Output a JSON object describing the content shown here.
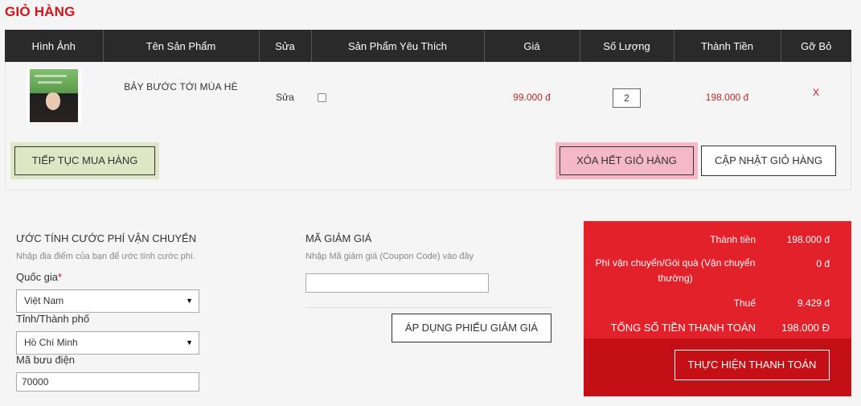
{
  "page": {
    "title": "GIỎ HÀNG"
  },
  "cart_table": {
    "headers": [
      "Hình Ảnh",
      "Tên Sản Phẩm",
      "Sửa",
      "Sản Phẩm Yêu Thích",
      "Giá",
      "Số Lượng",
      "Thành Tiền",
      "Gỡ Bỏ"
    ],
    "rows": [
      {
        "name": "BẢY BƯỚC TỚI MÙA HÈ",
        "edit": "Sửa",
        "favorite_checked": false,
        "price": "99.000 đ",
        "quantity": "2",
        "total": "198.000 đ",
        "remove": "X"
      }
    ]
  },
  "actions": {
    "continue": "TIẾP TỤC MUA HÀNG",
    "clear": "XÓA HẾT GIỎ HÀNG",
    "update": "CẬP NHẬT GIỎ HÀNG"
  },
  "shipping": {
    "title": "ƯỚC TÍNH CƯỚC PHÍ VẬN CHUYỂN",
    "description": "Nhập địa điểm của bạn để ước tính cước phí.",
    "country_label": "Quốc gia",
    "required_mark": "*",
    "country_value": "Việt Nam",
    "city_label": "Tỉnh/Thành phố",
    "city_value": "Hồ Chí Minh",
    "zip_label": "Mã bưu điện",
    "zip_value": "70000",
    "caret": "▼"
  },
  "coupon": {
    "title": "MÃ GIẢM GIÁ",
    "description": "Nhập Mã giảm giá (Coupon Code) vào đây",
    "input_value": "",
    "apply": "ÁP DỤNG PHIẾU GIẢM GIÁ"
  },
  "summary": {
    "subtotal_label": "Thành tiền",
    "subtotal_value": "198.000 đ",
    "shipping_label": "Phí vận chuyển/Gói quà (Vận chuyển thường)",
    "shipping_value": "0 đ",
    "tax_label": "Thuế",
    "tax_value": "9.429 đ",
    "grand_label": "TỔNG SỐ TIỀN THANH TOÁN",
    "grand_value": "198.000 Đ",
    "checkout": "THỰC HIỆN THANH TOÁN"
  },
  "colors": {
    "accent_red": "#d7141a",
    "summary_bg": "#e3212a",
    "checkout_bg": "#c40f16",
    "header_bg": "#2a2a2a"
  }
}
